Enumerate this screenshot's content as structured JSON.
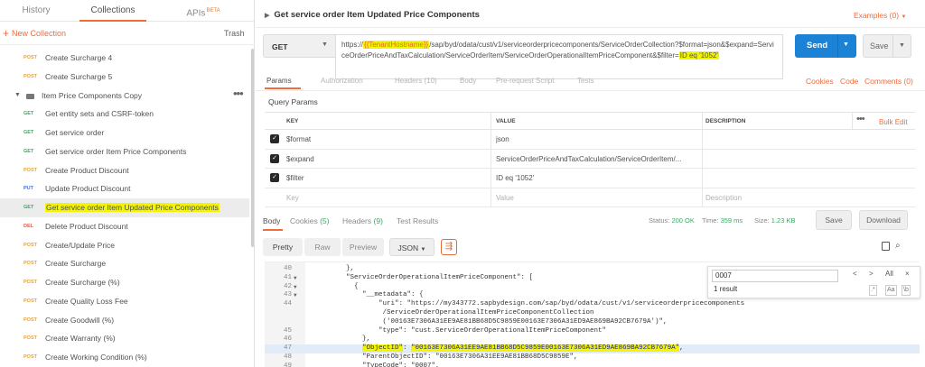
{
  "sidebar": {
    "tabs": [
      {
        "label": "History"
      },
      {
        "label": "Collections"
      },
      {
        "label": "APIs",
        "badge": "BETA"
      }
    ],
    "new_collection": "New Collection",
    "trash": "Trash",
    "items": [
      {
        "type": "request",
        "method": "POST",
        "label": "Create Surcharge 4"
      },
      {
        "type": "request",
        "method": "POST",
        "label": "Create Surcharge 5"
      },
      {
        "type": "folder",
        "label": "Item Price Components Copy"
      },
      {
        "type": "request",
        "method": "GET",
        "label": "Get entity sets and CSRF-token"
      },
      {
        "type": "request",
        "method": "GET",
        "label": "Get service order"
      },
      {
        "type": "request",
        "method": "GET",
        "label": "Get service order Item Price Components"
      },
      {
        "type": "request",
        "method": "POST",
        "label": "Create Product Discount"
      },
      {
        "type": "request",
        "method": "PUT",
        "label": "Update Product Discount"
      },
      {
        "type": "request",
        "method": "GET",
        "label": "Get service order Item Updated Price Components",
        "selected": true
      },
      {
        "type": "request",
        "method": "DEL",
        "label": "Delete Product Discount"
      },
      {
        "type": "request",
        "method": "POST",
        "label": "Create/Update Price"
      },
      {
        "type": "request",
        "method": "POST",
        "label": "Create Surcharge"
      },
      {
        "type": "request",
        "method": "POST",
        "label": "Create Surcharge (%)"
      },
      {
        "type": "request",
        "method": "POST",
        "label": "Create Quality Loss Fee"
      },
      {
        "type": "request",
        "method": "POST",
        "label": "Create Goodwill (%)"
      },
      {
        "type": "request",
        "method": "POST",
        "label": "Create Warranty (%)"
      },
      {
        "type": "request",
        "method": "POST",
        "label": "Create Working Condition (%)"
      }
    ]
  },
  "request": {
    "title": "Get service order Item Updated Price Components",
    "examples": "Examples (0)",
    "method": "GET",
    "url_prefix": "https://",
    "url_var": "{{TenantHostname}}",
    "url_rest": "/sap/byd/odata/cust/v1/serviceorderpricecomponents/ServiceOrderCollection?$format=json&$expand=ServiceOrderPriceAndTaxCalculation/ServiceOrderItem/ServiceOrderOperationalItemPriceComponent&$filter=",
    "url_filter": "ID eq '1052'",
    "send": "Send",
    "save": "Save"
  },
  "subtabs": [
    {
      "label": "Params",
      "active": true
    },
    {
      "label": "Authorization"
    },
    {
      "label": "Headers (10)"
    },
    {
      "label": "Body"
    },
    {
      "label": "Pre-request Script"
    },
    {
      "label": "Tests"
    }
  ],
  "links": {
    "cookies": "Cookies",
    "code": "Code",
    "comments": "Comments (0)"
  },
  "query_params": {
    "title": "Query Params",
    "headers": {
      "key": "KEY",
      "value": "VALUE",
      "description": "DESCRIPTION",
      "bulk_edit": "Bulk Edit"
    },
    "rows": [
      {
        "key": "$format",
        "value": "json",
        "description": ""
      },
      {
        "key": "$expand",
        "value": "ServiceOrderPriceAndTaxCalculation/ServiceOrderItem/...",
        "description": ""
      },
      {
        "key": "$filter",
        "value": "ID eq '1052'",
        "description": ""
      }
    ],
    "placeholder": {
      "key": "Key",
      "value": "Value",
      "description": "Description"
    }
  },
  "response": {
    "tabs": [
      {
        "label": "Body",
        "count": ""
      },
      {
        "label": "Cookies",
        "count": "(5)"
      },
      {
        "label": "Headers",
        "count": "(9)"
      },
      {
        "label": "Test Results",
        "count": ""
      }
    ],
    "status_label": "Status:",
    "status_value": "200 OK",
    "time_label": "Time:",
    "time_value": "359 ms",
    "size_label": "Size:",
    "size_value": "1.23 KB",
    "save": "Save",
    "download": "Download",
    "view_modes": [
      "Pretty",
      "Raw",
      "Preview"
    ],
    "format": "JSON",
    "find_query": "0007",
    "find_result": "1 result",
    "find_all": "All",
    "code_lines": [
      {
        "n": "40",
        "indent": 10,
        "text": "},"
      },
      {
        "n": "41",
        "indent": 10,
        "text": "\"ServiceOrderOperationalItemPriceComponent\": [",
        "fold": true
      },
      {
        "n": "42",
        "indent": 12,
        "text": "{",
        "fold": true
      },
      {
        "n": "43",
        "indent": 14,
        "text": "\"__metadata\": {",
        "fold": true
      },
      {
        "n": "44",
        "indent": 18,
        "text": "\"uri\": \"https://my343772.sapbydesign.com/sap/byd/odata/cust/v1/serviceorderpricecomponents"
      },
      {
        "n": "",
        "indent": 19,
        "text": "/ServiceOrderOperationalItemPriceComponentCollection"
      },
      {
        "n": "",
        "indent": 19,
        "text": "('00163E7306A31EE9AE81BB68D5C9859E00163E7306A31ED9AE869BA92CB7679A')\","
      },
      {
        "n": "45",
        "indent": 18,
        "text": "\"type\": \"cust.ServiceOrderOperationalItemPriceComponent\""
      },
      {
        "n": "46",
        "indent": 14,
        "text": "},"
      },
      {
        "n": "47",
        "indent": 14,
        "text": "\"ObjectID\": \"00163E7306A31EE9AE81BB68D5C9859E00163E7306A31ED9AE869BA92CB7679A\",",
        "current": true
      },
      {
        "n": "48",
        "indent": 14,
        "text": "\"ParentObjectID\": \"00163E7306A31EE9AE81BB68D5C9859E\","
      },
      {
        "n": "49",
        "indent": 14,
        "text": "\"TypeCode\": \"0007\","
      }
    ]
  },
  "colors": {
    "accent": "#f26b3a",
    "send": "#1b82d6",
    "highlight": "#f3f500",
    "ok": "#3fa566"
  }
}
